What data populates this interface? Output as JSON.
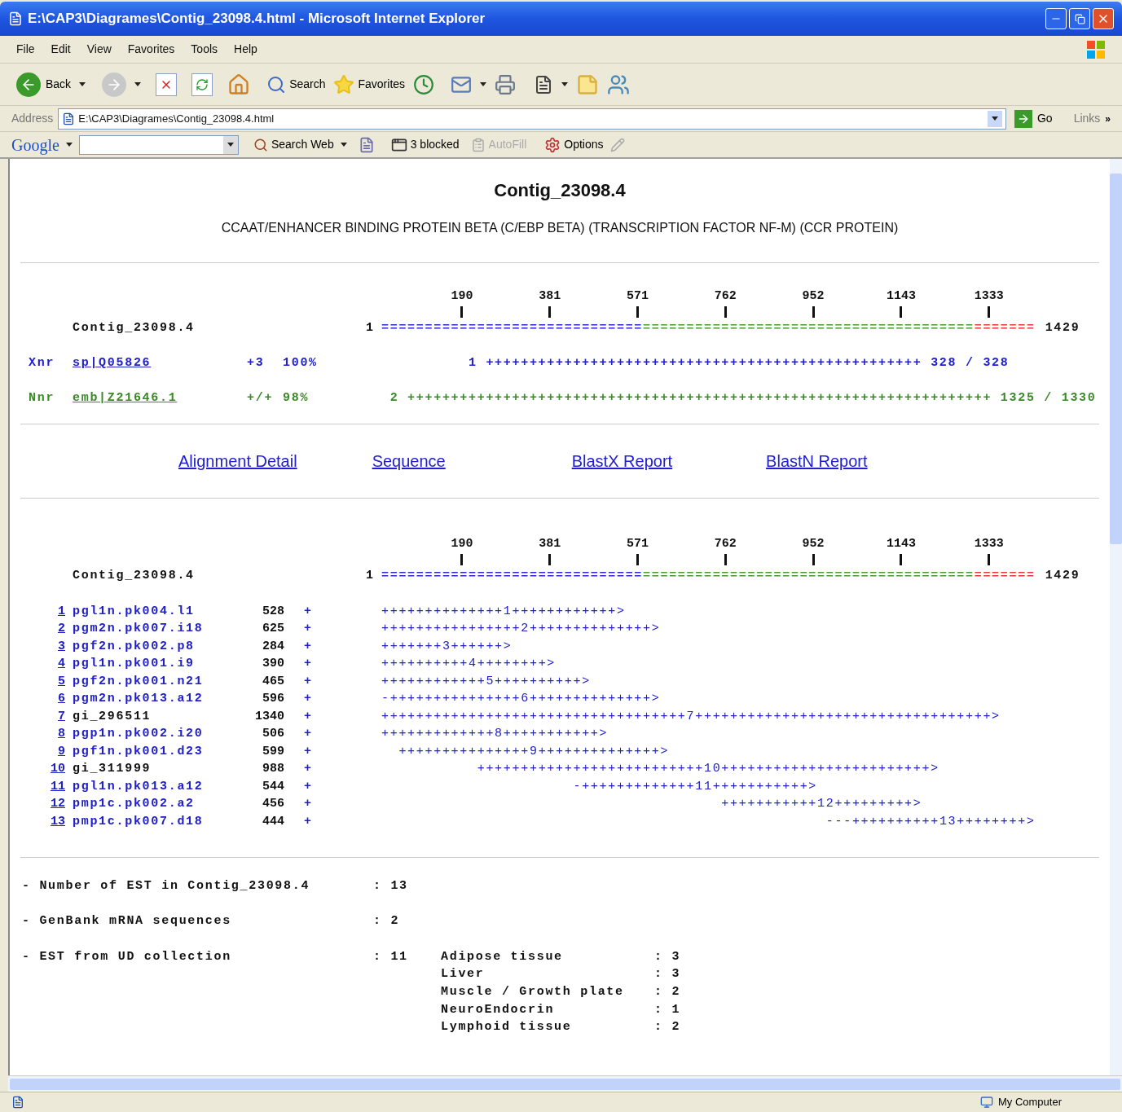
{
  "window": {
    "title": "E:\\CAP3\\Diagrames\\Contig_23098.4.html - Microsoft Internet Explorer"
  },
  "menu": [
    "File",
    "Edit",
    "View",
    "Favorites",
    "Tools",
    "Help"
  ],
  "toolbar": {
    "back": "Back",
    "search": "Search",
    "favorites": "Favorites"
  },
  "address": {
    "label": "Address",
    "value": "E:\\CAP3\\Diagrames\\Contig_23098.4.html",
    "go": "Go",
    "links": "Links",
    "more": "»"
  },
  "google_bar": {
    "logo": "Google",
    "search_web": "Search Web",
    "blocked": "3 blocked",
    "autofill": {
      "label": "AutoFill",
      "disabled": true
    },
    "options": "Options"
  },
  "page": {
    "title": "Contig_23098.4",
    "subtitle": "CCAAT/ENHANCER BINDING PROTEIN BETA (C/EBP BETA) (TRANSCRIPTION FACTOR NF-M) (CCR PROTEIN)",
    "overview": {
      "ruler": [
        "190",
        "381",
        "571",
        "762",
        "952",
        "1143",
        "1333"
      ],
      "contig": {
        "name": "Contig_23098.4",
        "start": "1",
        "end": "1429",
        "segments": [
          {
            "text": "==============================",
            "color": "#2a2ad0"
          },
          {
            "text": "======================================",
            "color": "#4a9a30"
          },
          {
            "text": "=======",
            "color": "#e03a3a"
          }
        ]
      },
      "hits": [
        {
          "tag": "Xnr",
          "accession": "sp|Q05826",
          "frame": "+3",
          "identity": "100%",
          "start": "          1",
          "track": "++++++++++++++++++++++++++++++++++++++++++++++++++",
          "span": "328 / 328",
          "color": "#2020d0"
        },
        {
          "tag": "Nnr",
          "accession": "emb|Z21646.1",
          "frame": "+/+",
          "identity": "98%",
          "start": " 2",
          "track": "+++++++++++++++++++++++++++++++++++++++++++++++++++++++++++++++++++",
          "span": "1325 / 1330",
          "color": "#3a8a28"
        }
      ]
    },
    "links": [
      "Alignment Detail",
      "Sequence",
      "BlastX Report",
      "BlastN Report"
    ],
    "assembly": {
      "ruler": [
        "190",
        "381",
        "571",
        "762",
        "952",
        "1143",
        "1333"
      ],
      "contig": {
        "name": "Contig_23098.4",
        "start": "1",
        "end": "1429",
        "segments": [
          {
            "text": "==============================",
            "color": "#2a2ad0"
          },
          {
            "text": "======================================",
            "color": "#4a9a30"
          },
          {
            "text": "=======",
            "color": "#e03a3a"
          }
        ]
      },
      "ests": [
        {
          "number": "1",
          "name": "pgl1n.pk004.l1",
          "color": "#2020c8",
          "length": "528",
          "strand": "+",
          "track": "++++++++++++++1++++++++++++>"
        },
        {
          "number": "2",
          "name": "pgm2n.pk007.i18",
          "color": "#2020c8",
          "length": "625",
          "strand": "+",
          "track": "++++++++++++++++2++++++++++++++>"
        },
        {
          "number": "3",
          "name": "pgf2n.pk002.p8",
          "color": "#2020c8",
          "length": "284",
          "strand": "+",
          "track": "+++++++3++++++>"
        },
        {
          "number": "4",
          "name": "pgl1n.pk001.i9",
          "color": "#2020c8",
          "length": "390",
          "strand": "+",
          "track": "++++++++++4++++++++>"
        },
        {
          "number": "5",
          "name": "pgf2n.pk001.n21",
          "color": "#2020c8",
          "length": "465",
          "strand": "+",
          "track": "++++++++++++5++++++++++>"
        },
        {
          "number": "6",
          "name": "pgm2n.pk013.a12",
          "color": "#2020c8",
          "length": "596",
          "strand": "+",
          "track": "-+++++++++++++++6++++++++++++++>"
        },
        {
          "number": "7",
          "name": "gi_296511",
          "color": "#111111",
          "length": "1340",
          "strand": "+",
          "track": "+++++++++++++++++++++++++++++++++++7++++++++++++++++++++++++++++++++++>"
        },
        {
          "number": "8",
          "name": "pgp1n.pk002.i20",
          "color": "#2020c8",
          "length": "506",
          "strand": "+",
          "track": "+++++++++++++8+++++++++++>"
        },
        {
          "number": "9",
          "name": "pgf1n.pk001.d23",
          "color": "#2020c8",
          "length": "599",
          "strand": "+",
          "track": "  +++++++++++++++9++++++++++++++>"
        },
        {
          "number": "10",
          "name": "gi_311999",
          "color": "#111111",
          "length": "988",
          "strand": "+",
          "track": "           ++++++++++++++++++++++++++10++++++++++++++++++++++++>"
        },
        {
          "number": "11",
          "name": "pgl1n.pk013.a12",
          "color": "#2020c8",
          "length": "544",
          "strand": "+",
          "track": "                      -+++++++++++++11+++++++++++>"
        },
        {
          "number": "12",
          "name": "pmp1c.pk002.a2",
          "color": "#2020c8",
          "length": "456",
          "strand": "+",
          "track": "                                       +++++++++++12+++++++++>"
        },
        {
          "number": "13",
          "name": "pmp1c.pk007.d18",
          "color": "#2020c8",
          "length": "444",
          "strand": "+",
          "track": "                                                   ---++++++++++13++++++++>"
        }
      ]
    },
    "stats": [
      {
        "label": "- Number of EST in Contig_23098.4",
        "value": ": 13"
      },
      {
        "label": "- GenBank mRNA sequences",
        "value": ": 2"
      },
      {
        "label": "- EST from UD collection",
        "value": ": 11",
        "details": [
          {
            "tissue": "Adipose tissue",
            "count": ": 3"
          },
          {
            "tissue": "Liver",
            "count": ": 3"
          },
          {
            "tissue": "Muscle / Growth plate",
            "count": ": 2"
          },
          {
            "tissue": "NeuroEndocrin",
            "count": ": 1"
          },
          {
            "tissue": "Lymphoid tissue",
            "count": ": 2"
          }
        ]
      }
    ]
  },
  "status_bar": {
    "zone": "My Computer"
  }
}
